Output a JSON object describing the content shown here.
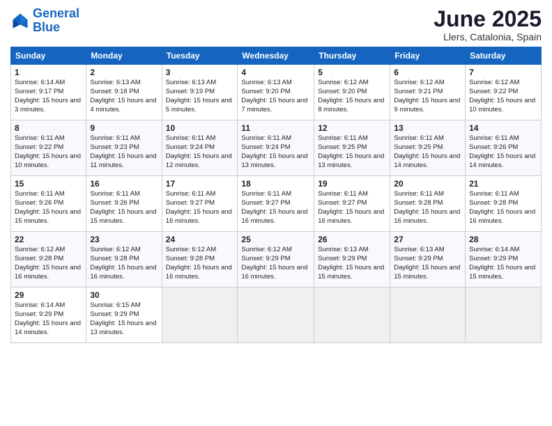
{
  "logo": {
    "line1": "General",
    "line2": "Blue"
  },
  "title": "June 2025",
  "subtitle": "Llers, Catalonia, Spain",
  "headers": [
    "Sunday",
    "Monday",
    "Tuesday",
    "Wednesday",
    "Thursday",
    "Friday",
    "Saturday"
  ],
  "weeks": [
    [
      {
        "day": "1",
        "sunrise": "6:14 AM",
        "sunset": "9:17 PM",
        "daylight": "15 hours and 3 minutes."
      },
      {
        "day": "2",
        "sunrise": "6:13 AM",
        "sunset": "9:18 PM",
        "daylight": "15 hours and 4 minutes."
      },
      {
        "day": "3",
        "sunrise": "6:13 AM",
        "sunset": "9:19 PM",
        "daylight": "15 hours and 5 minutes."
      },
      {
        "day": "4",
        "sunrise": "6:13 AM",
        "sunset": "9:20 PM",
        "daylight": "15 hours and 7 minutes."
      },
      {
        "day": "5",
        "sunrise": "6:12 AM",
        "sunset": "9:20 PM",
        "daylight": "15 hours and 8 minutes."
      },
      {
        "day": "6",
        "sunrise": "6:12 AM",
        "sunset": "9:21 PM",
        "daylight": "15 hours and 9 minutes."
      },
      {
        "day": "7",
        "sunrise": "6:12 AM",
        "sunset": "9:22 PM",
        "daylight": "15 hours and 10 minutes."
      }
    ],
    [
      {
        "day": "8",
        "sunrise": "6:11 AM",
        "sunset": "9:22 PM",
        "daylight": "15 hours and 10 minutes."
      },
      {
        "day": "9",
        "sunrise": "6:11 AM",
        "sunset": "9:23 PM",
        "daylight": "15 hours and 11 minutes."
      },
      {
        "day": "10",
        "sunrise": "6:11 AM",
        "sunset": "9:24 PM",
        "daylight": "15 hours and 12 minutes."
      },
      {
        "day": "11",
        "sunrise": "6:11 AM",
        "sunset": "9:24 PM",
        "daylight": "15 hours and 13 minutes."
      },
      {
        "day": "12",
        "sunrise": "6:11 AM",
        "sunset": "9:25 PM",
        "daylight": "15 hours and 13 minutes."
      },
      {
        "day": "13",
        "sunrise": "6:11 AM",
        "sunset": "9:25 PM",
        "daylight": "15 hours and 14 minutes."
      },
      {
        "day": "14",
        "sunrise": "6:11 AM",
        "sunset": "9:26 PM",
        "daylight": "15 hours and 14 minutes."
      }
    ],
    [
      {
        "day": "15",
        "sunrise": "6:11 AM",
        "sunset": "9:26 PM",
        "daylight": "15 hours and 15 minutes."
      },
      {
        "day": "16",
        "sunrise": "6:11 AM",
        "sunset": "9:26 PM",
        "daylight": "15 hours and 15 minutes."
      },
      {
        "day": "17",
        "sunrise": "6:11 AM",
        "sunset": "9:27 PM",
        "daylight": "15 hours and 16 minutes."
      },
      {
        "day": "18",
        "sunrise": "6:11 AM",
        "sunset": "9:27 PM",
        "daylight": "15 hours and 16 minutes."
      },
      {
        "day": "19",
        "sunrise": "6:11 AM",
        "sunset": "9:27 PM",
        "daylight": "15 hours and 16 minutes."
      },
      {
        "day": "20",
        "sunrise": "6:11 AM",
        "sunset": "9:28 PM",
        "daylight": "15 hours and 16 minutes."
      },
      {
        "day": "21",
        "sunrise": "6:11 AM",
        "sunset": "9:28 PM",
        "daylight": "15 hours and 16 minutes."
      }
    ],
    [
      {
        "day": "22",
        "sunrise": "6:12 AM",
        "sunset": "9:28 PM",
        "daylight": "15 hours and 16 minutes."
      },
      {
        "day": "23",
        "sunrise": "6:12 AM",
        "sunset": "9:28 PM",
        "daylight": "15 hours and 16 minutes."
      },
      {
        "day": "24",
        "sunrise": "6:12 AM",
        "sunset": "9:28 PM",
        "daylight": "15 hours and 16 minutes."
      },
      {
        "day": "25",
        "sunrise": "6:12 AM",
        "sunset": "9:29 PM",
        "daylight": "15 hours and 16 minutes."
      },
      {
        "day": "26",
        "sunrise": "6:13 AM",
        "sunset": "9:29 PM",
        "daylight": "15 hours and 15 minutes."
      },
      {
        "day": "27",
        "sunrise": "6:13 AM",
        "sunset": "9:29 PM",
        "daylight": "15 hours and 15 minutes."
      },
      {
        "day": "28",
        "sunrise": "6:14 AM",
        "sunset": "9:29 PM",
        "daylight": "15 hours and 15 minutes."
      }
    ],
    [
      {
        "day": "29",
        "sunrise": "6:14 AM",
        "sunset": "9:29 PM",
        "daylight": "15 hours and 14 minutes."
      },
      {
        "day": "30",
        "sunrise": "6:15 AM",
        "sunset": "9:29 PM",
        "daylight": "15 hours and 13 minutes."
      },
      null,
      null,
      null,
      null,
      null
    ]
  ]
}
